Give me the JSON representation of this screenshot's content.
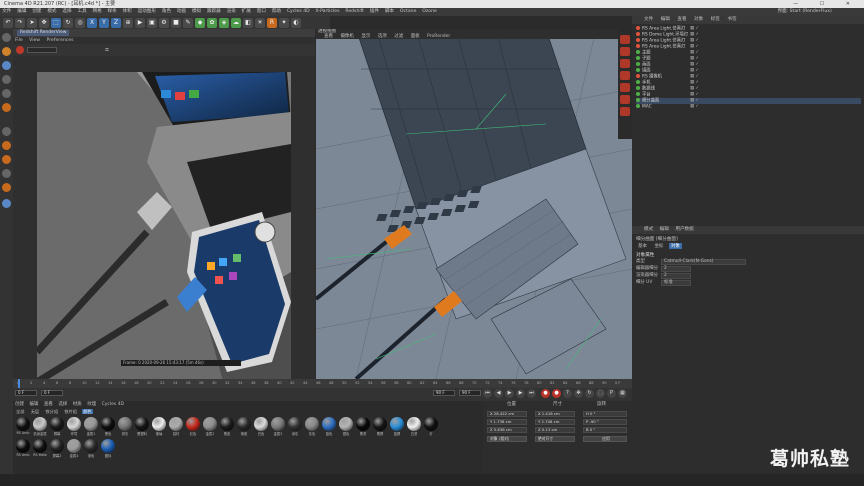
{
  "window": {
    "title": "Cinema 4D R21.207 (RC) - [耳机.c4d *] - 主要"
  },
  "menubar": {
    "items": [
      "文件",
      "编辑",
      "创建",
      "模式",
      "选择",
      "工具",
      "网格",
      "样条",
      "体积",
      "运动图形",
      "角色",
      "动画",
      "模拟",
      "跟踪器",
      "渲染",
      "扩展",
      "窗口",
      "帮助",
      "Cycles 4D",
      "X-Particles",
      "Redshift",
      "插件",
      "脚本",
      "Octane",
      "Ozone"
    ],
    "layout_label": "界面: Start (RenderFlux)"
  },
  "picture_viewer": {
    "tab": "Redshift RenderView",
    "menu": [
      "File",
      "View",
      "Preferences"
    ],
    "status": "Frame: 0   2020-09-26  15:43:17   (5m 46s)"
  },
  "viewport": {
    "label": "透视视图",
    "menu": [
      "查看",
      "摄像机",
      "显示",
      "选项",
      "过滤",
      "面板",
      "ProRender"
    ]
  },
  "object_manager": {
    "menu": [
      "文件",
      "编辑",
      "查看",
      "对象",
      "标签",
      "书签"
    ],
    "objects": [
      {
        "name": "RS Area Light.仿真灯",
        "color": "#e0533a"
      },
      {
        "name": "RS Dome Light.环境灯",
        "color": "#e0533a"
      },
      {
        "name": "RS Area Light.仿真灯",
        "color": "#e0533a"
      },
      {
        "name": "RS Area Light.仿真灯",
        "color": "#e0533a"
      },
      {
        "name": "主题",
        "color": "#4fb04a"
      },
      {
        "name": "子题",
        "color": "#4fb04a"
      },
      {
        "name": "画面",
        "color": "#4fb04a"
      },
      {
        "name": "镜面",
        "color": "#4fb04a"
      },
      {
        "name": "RS 摄像机",
        "color": "#e0533a"
      },
      {
        "name": "手机",
        "color": "#4fb04a"
      },
      {
        "name": "数据线",
        "color": "#4fb04a"
      },
      {
        "name": "平台",
        "color": "#4fb04a"
      },
      {
        "name": "细分曲面",
        "color": "#4fb04a"
      },
      {
        "name": "MAC",
        "color": "#4fb04a"
      }
    ]
  },
  "attribute_manager": {
    "menu": [
      "模式",
      "编辑",
      "用户数据"
    ],
    "object_label": "细分曲面 [细分曲面]",
    "tabs": [
      "基本",
      "坐标",
      "对象"
    ],
    "active_tab": "对象",
    "section": "对象属性",
    "fields": [
      {
        "label": "类型",
        "value": "Catmull-Clark(N-Gons)"
      },
      {
        "label": "编辑器细分",
        "value": "2"
      },
      {
        "label": "渲染器细分",
        "value": "2"
      },
      {
        "label": "细分 UV",
        "value": "标准"
      }
    ]
  },
  "timeline": {
    "ticks": [
      "0",
      "2",
      "4",
      "6",
      "8",
      "10",
      "12",
      "14",
      "16",
      "18",
      "20",
      "22",
      "24",
      "26",
      "28",
      "30",
      "32",
      "34",
      "36",
      "38",
      "40",
      "42",
      "44",
      "46",
      "48",
      "50",
      "52",
      "54",
      "56",
      "58",
      "60",
      "62",
      "64",
      "66",
      "68",
      "70",
      "72",
      "74",
      "76",
      "78",
      "80",
      "82",
      "84",
      "86",
      "88",
      "90"
    ],
    "start_frame": "0 F",
    "current_frame": "0 F",
    "end_frame": "90 F",
    "max_frame": "90 F",
    "current_frame_label": "0 F"
  },
  "material_manager": {
    "menu": [
      "创建",
      "编辑",
      "查看",
      "选择",
      "材质",
      "纹理",
      "Cycles 4D"
    ],
    "filters": [
      "全部",
      "无层",
      "铁分组",
      "铁片组",
      "颜色"
    ],
    "active_filter": "颜色",
    "materials": [
      {
        "name": "RS Amb",
        "color": "#111"
      },
      {
        "name": "机身金属",
        "color": "#c9c9c9"
      },
      {
        "name": "屏幕",
        "color": "#1b1b1b"
      },
      {
        "name": "环境",
        "color": "#d8d8d8"
      },
      {
        "name": "金属1",
        "color": "#9a9a9a"
      },
      {
        "name": "黑色",
        "color": "#0e0e0e"
      },
      {
        "name": "铁灰",
        "color": "#777"
      },
      {
        "name": "黑塑料",
        "color": "#151515"
      },
      {
        "name": "玻璃",
        "color": "#ececec"
      },
      {
        "name": "铝材",
        "color": "#adadad"
      },
      {
        "name": "红色",
        "color": "#c62a1e"
      },
      {
        "name": "金属2",
        "color": "#8e8e8e"
      },
      {
        "name": "黑皮",
        "color": "#1c1c1c"
      },
      {
        "name": "橡胶",
        "color": "#2a2a2a"
      },
      {
        "name": "白色",
        "color": "#dcdcdc"
      },
      {
        "name": "金属3",
        "color": "#7a7a7a"
      },
      {
        "name": "深灰",
        "color": "#333"
      },
      {
        "name": "灰色",
        "color": "#888"
      },
      {
        "name": "蓝色",
        "color": "#2f6fc2"
      },
      {
        "name": "银色",
        "color": "#b5b5b5"
      },
      {
        "name": "黑漆",
        "color": "#0a0a0a"
      },
      {
        "name": "黑屏",
        "color": "#151515"
      },
      {
        "name": "蓝屏",
        "color": "#2a8fd9"
      },
      {
        "name": "白漆",
        "color": "#f0f0f0"
      },
      {
        "name": "灯",
        "color": "#111"
      },
      {
        "name": "RS Amb",
        "color": "#0c0c0c"
      },
      {
        "name": "RS Mate",
        "color": "#101010"
      },
      {
        "name": "屏幕2",
        "color": "#222"
      },
      {
        "name": "金属4",
        "color": "#9c9c9c"
      },
      {
        "name": "深色",
        "color": "#2a2a2a"
      },
      {
        "name": "图标",
        "color": "#1d5fb5"
      }
    ]
  },
  "coordinates": {
    "headers": [
      "位置",
      "尺寸",
      "旋转"
    ],
    "rows": [
      {
        "pos": "X 28.422 cm",
        "size": "X 1.418 cm",
        "rot": "H 0 °"
      },
      {
        "pos": "Y 1.736 cm",
        "size": "Y 2.708 cm",
        "rot": "P -90 °"
      },
      {
        "pos": "Z 5.638 cm",
        "size": "Z 0.13 cm",
        "rot": "B 0 °"
      }
    ],
    "mode": "对象 (相对)",
    "size_mode": "绝对尺寸",
    "apply": "应用"
  },
  "watermark": "葛帅私塾"
}
